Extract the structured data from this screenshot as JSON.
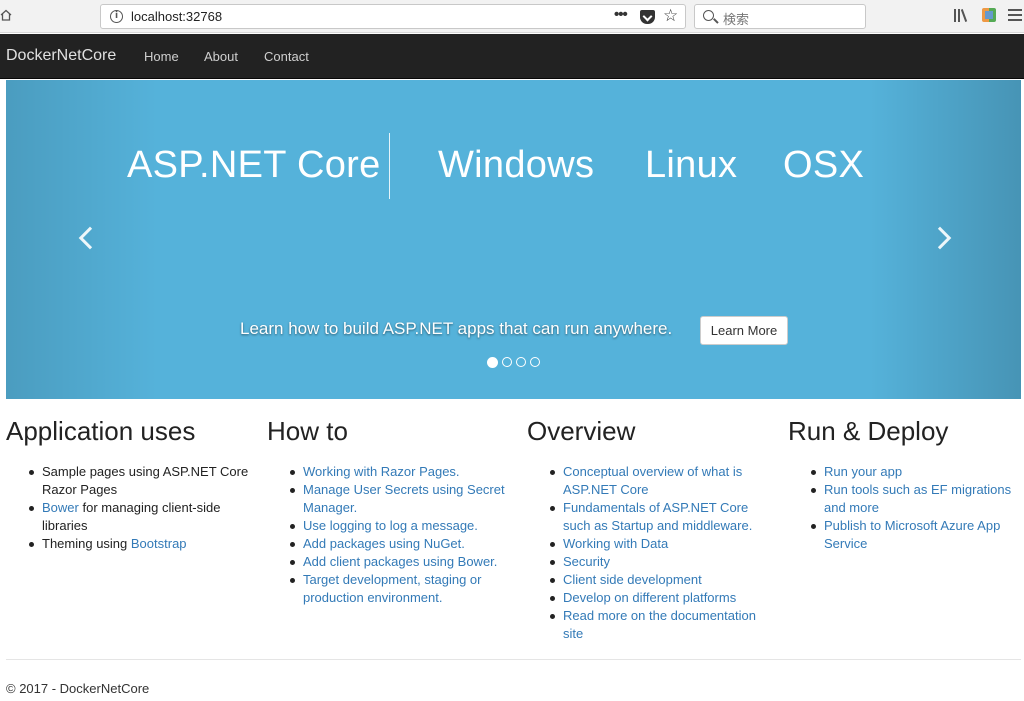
{
  "browser": {
    "url": "localhost:32768",
    "more_glyph": "•••",
    "star_glyph": "☆",
    "info_glyph": "i",
    "search_placeholder": "検索"
  },
  "navbar": {
    "brand": "DockerNetCore",
    "links": [
      "Home",
      "About",
      "Contact"
    ]
  },
  "carousel": {
    "background": "#55b2da",
    "headline": "ASP.NET Core",
    "platforms": [
      "Windows",
      "Linux",
      "OSX"
    ],
    "caption": "Learn how to build ASP.NET apps that can run anywhere.",
    "button_label": "Learn More",
    "slide_count": 4,
    "active_slide": 1
  },
  "columns": [
    {
      "title": "Application uses",
      "items": [
        [
          {
            "t": "Sample pages using ASP.NET Core"
          },
          {
            "br": true
          },
          {
            "t": "Razor Pages"
          }
        ],
        [
          {
            "t": "Bower",
            "link": true
          },
          {
            "t": " for managing client-side"
          },
          {
            "br": true
          },
          {
            "t": "libraries"
          }
        ],
        [
          {
            "t": "Theming using "
          },
          {
            "t": "Bootstrap",
            "link": true
          }
        ]
      ]
    },
    {
      "title": "How to",
      "items": [
        [
          {
            "t": "Working with Razor Pages.",
            "link": true
          }
        ],
        [
          {
            "t": "Manage User Secrets using Secret",
            "link": true
          },
          {
            "br": true
          },
          {
            "t": "Manager.",
            "link": true
          }
        ],
        [
          {
            "t": "Use logging to log a message.",
            "link": true
          }
        ],
        [
          {
            "t": "Add packages using NuGet.",
            "link": true
          }
        ],
        [
          {
            "t": "Add client packages using Bower.",
            "link": true
          }
        ],
        [
          {
            "t": "Target development, staging or",
            "link": true
          },
          {
            "br": true
          },
          {
            "t": "production environment.",
            "link": true
          }
        ]
      ]
    },
    {
      "title": "Overview",
      "items": [
        [
          {
            "t": "Conceptual overview of what is",
            "link": true
          },
          {
            "br": true
          },
          {
            "t": "ASP.NET Core",
            "link": true
          }
        ],
        [
          {
            "t": "Fundamentals of ASP.NET Core",
            "link": true
          },
          {
            "br": true
          },
          {
            "t": "such as Startup and middleware.",
            "link": true
          }
        ],
        [
          {
            "t": "Working with Data",
            "link": true
          }
        ],
        [
          {
            "t": "Security",
            "link": true
          }
        ],
        [
          {
            "t": "Client side development",
            "link": true
          }
        ],
        [
          {
            "t": "Develop on different platforms",
            "link": true
          }
        ],
        [
          {
            "t": "Read more on the documentation",
            "link": true
          },
          {
            "br": true
          },
          {
            "t": "site",
            "link": true
          }
        ]
      ]
    },
    {
      "title": "Run & Deploy",
      "items": [
        [
          {
            "t": "Run your app",
            "link": true
          }
        ],
        [
          {
            "t": "Run tools such as EF migrations",
            "link": true
          },
          {
            "br": true
          },
          {
            "t": "and more",
            "link": true
          }
        ],
        [
          {
            "t": "Publish to Microsoft Azure App",
            "link": true
          },
          {
            "br": true
          },
          {
            "t": "Service",
            "link": true
          }
        ]
      ]
    }
  ],
  "footer": {
    "text": "© 2017 - DockerNetCore"
  }
}
